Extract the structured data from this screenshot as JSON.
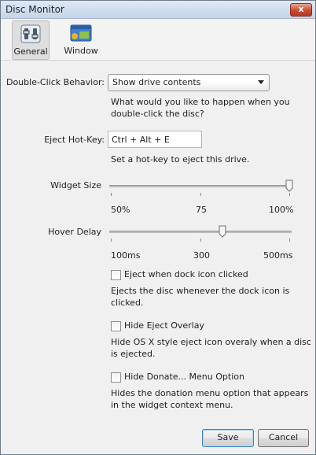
{
  "window": {
    "title": "Disc Monitor",
    "close_label": "x"
  },
  "toolbar": {
    "tabs": [
      {
        "label": "General",
        "icon": "settings-switches-icon",
        "active": true
      },
      {
        "label": "Window",
        "icon": "window-icon",
        "active": false
      }
    ]
  },
  "double_click": {
    "label": "Double-Click Behavior:",
    "selected": "Show drive contents",
    "hint_line1": "What would you like to happen when you",
    "hint_line2": "double-click the disc?"
  },
  "eject_hotkey": {
    "label": "Eject Hot-Key:",
    "value": "Ctrl + Alt + E",
    "hint": "Set a hot-key to eject this drive."
  },
  "widget_size": {
    "label": "Widget Size",
    "value_percent": 100,
    "ticks": [
      "50%",
      "75",
      "100%"
    ]
  },
  "hover_delay": {
    "label": "Hover Delay",
    "value_ms": 350,
    "ticks": [
      "100ms",
      "300",
      "500ms"
    ]
  },
  "options": [
    {
      "label": "Eject when dock icon clicked",
      "checked": false,
      "desc1": "Ejects the disc whenever the dock icon is",
      "desc2": "clicked."
    },
    {
      "label": "Hide Eject Overlay",
      "checked": false,
      "desc1": "Hide OS X style eject icon overaly when a disc",
      "desc2": "is ejected."
    },
    {
      "label": "Hide Donate... Menu Option",
      "checked": false,
      "desc1": "Hides the donation menu option that appears",
      "desc2": "in the widget context menu."
    }
  ],
  "buttons": {
    "save": "Save",
    "cancel": "Cancel"
  },
  "colors": {
    "accent": "#3c7fb1",
    "close": "#c94a33",
    "background": "#f0f0f0"
  }
}
